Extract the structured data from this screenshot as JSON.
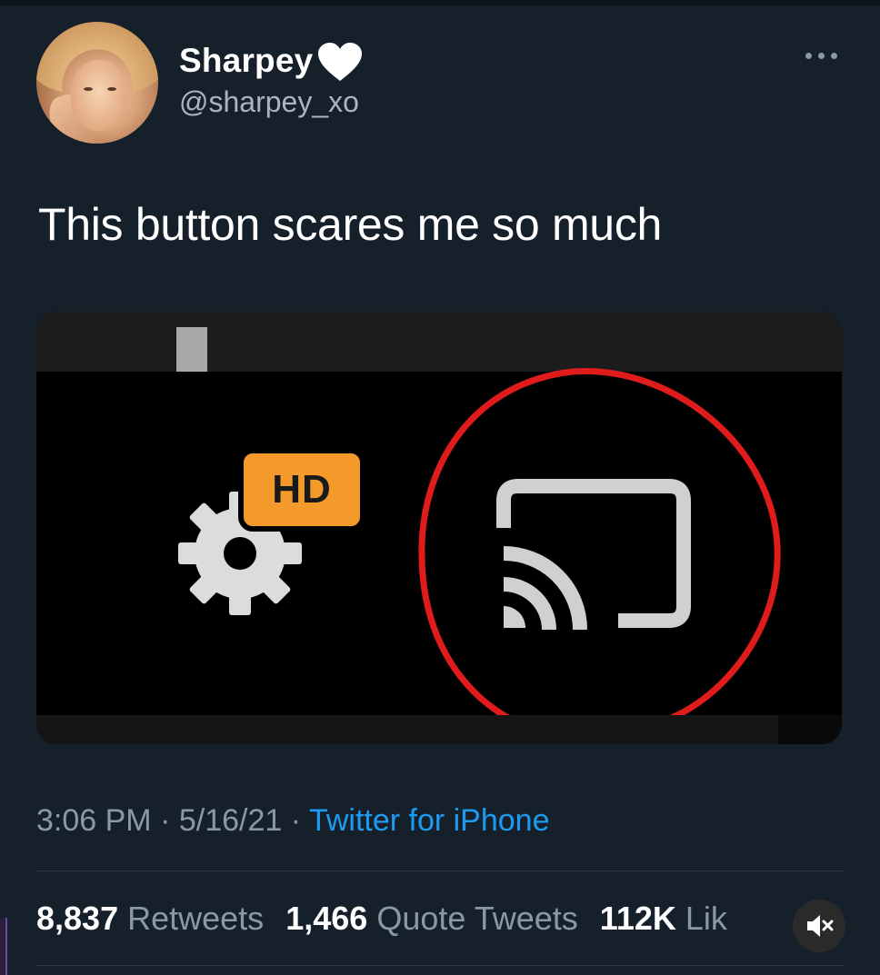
{
  "author": {
    "display_name": "Sharpey",
    "handle": "@sharpey_xo",
    "name_emoji": "white-heart-icon"
  },
  "tweet": {
    "text": "This button scares me so much"
  },
  "media": {
    "badge_text": "HD",
    "icons": [
      "gear-icon",
      "cast-icon"
    ],
    "annotation_color": "#e01b1b",
    "badge_color": "#f39a2a"
  },
  "meta": {
    "time": "3:06 PM",
    "date": "5/16/21",
    "source": "Twitter for iPhone",
    "separator": "·"
  },
  "stats": {
    "retweets_count": "8,837",
    "retweets_label": "Retweets",
    "quotes_count": "1,466",
    "quotes_label": "Quote Tweets",
    "likes_count": "112K",
    "likes_label": "Lik"
  },
  "colors": {
    "background": "#15202b",
    "link": "#1d9bf0",
    "secondary_text": "#8b98a5"
  }
}
